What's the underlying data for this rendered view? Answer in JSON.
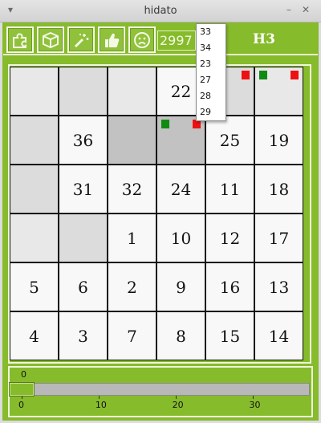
{
  "window": {
    "title": "hidato",
    "menu_glyph": "▾",
    "minimize_glyph": "–",
    "close_glyph": "✕"
  },
  "toolbar": {
    "buttons": [
      {
        "name": "puzzle-piece-icon",
        "color": "#f4f9e6"
      },
      {
        "name": "cube-icon",
        "color": "#f4f9e6"
      },
      {
        "name": "magic-wand-icon",
        "color": "#f4f9e6"
      },
      {
        "name": "thumbs-up-icon",
        "color": "#f4f9e6"
      },
      {
        "name": "sad-face-icon",
        "color": "#f4f9e6"
      }
    ],
    "score": "2997",
    "level": "H3"
  },
  "dropdown": {
    "options": [
      "33",
      "34",
      "23",
      "27",
      "28",
      "29"
    ]
  },
  "board": {
    "rows": [
      [
        {
          "v": "",
          "s": "blank"
        },
        {
          "v": "",
          "s": "empty"
        },
        {
          "v": "",
          "s": "blank"
        },
        {
          "v": "22",
          "s": "filled"
        },
        {
          "v": "",
          "s": "empty",
          "red": true
        },
        {
          "v": "",
          "s": "blank",
          "green": true,
          "red": true
        }
      ],
      [
        {
          "v": "",
          "s": "empty"
        },
        {
          "v": "36",
          "s": "filled"
        },
        {
          "v": "",
          "s": "sel"
        },
        {
          "v": "",
          "s": "sel",
          "green": true,
          "red": true
        },
        {
          "v": "25",
          "s": "filled"
        },
        {
          "v": "19",
          "s": "filled"
        }
      ],
      [
        {
          "v": "",
          "s": "empty"
        },
        {
          "v": "31",
          "s": "filled"
        },
        {
          "v": "32",
          "s": "filled"
        },
        {
          "v": "24",
          "s": "filled"
        },
        {
          "v": "11",
          "s": "filled"
        },
        {
          "v": "18",
          "s": "filled"
        }
      ],
      [
        {
          "v": "",
          "s": "blank"
        },
        {
          "v": "",
          "s": "empty"
        },
        {
          "v": "1",
          "s": "filled"
        },
        {
          "v": "10",
          "s": "filled"
        },
        {
          "v": "12",
          "s": "filled"
        },
        {
          "v": "17",
          "s": "filled"
        }
      ],
      [
        {
          "v": "5",
          "s": "filled"
        },
        {
          "v": "6",
          "s": "filled"
        },
        {
          "v": "2",
          "s": "filled"
        },
        {
          "v": "9",
          "s": "filled"
        },
        {
          "v": "16",
          "s": "filled"
        },
        {
          "v": "13",
          "s": "filled"
        }
      ],
      [
        {
          "v": "4",
          "s": "filled"
        },
        {
          "v": "3",
          "s": "filled"
        },
        {
          "v": "7",
          "s": "filled"
        },
        {
          "v": "8",
          "s": "filled"
        },
        {
          "v": "15",
          "s": "filled"
        },
        {
          "v": "14",
          "s": "filled"
        }
      ]
    ]
  },
  "slider": {
    "value": "0",
    "min": 0,
    "max": 36,
    "ticks": [
      "0",
      "10",
      "20",
      "30"
    ],
    "tick_values": [
      0,
      10,
      20,
      30
    ]
  },
  "colors": {
    "accent": "#86bb2b",
    "marker_red": "#ee1111",
    "marker_green": "#118a11"
  }
}
